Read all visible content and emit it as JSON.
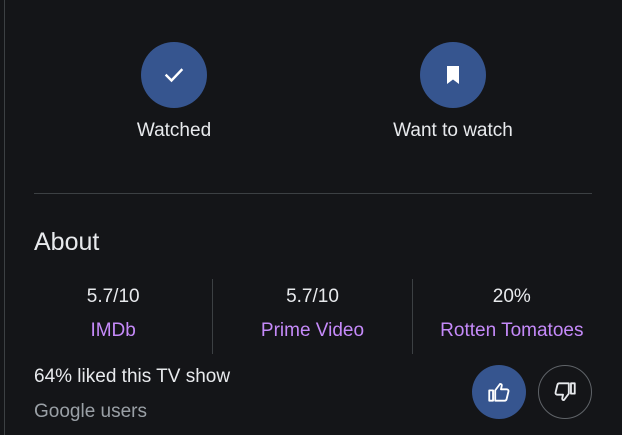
{
  "actions": {
    "watched": {
      "label": "Watched",
      "icon": "check-icon"
    },
    "want_to_watch": {
      "label": "Want to watch",
      "icon": "bookmark-icon"
    }
  },
  "about": {
    "title": "About",
    "ratings": [
      {
        "value": "5.7/10",
        "source": "IMDb"
      },
      {
        "value": "5.7/10",
        "source": "Prime Video"
      },
      {
        "value": "20%",
        "source": "Rotten Tomatoes"
      }
    ]
  },
  "audience": {
    "liked_text": "64% liked this TV show",
    "source_text": "Google users",
    "thumbs_up_icon": "thumbs-up-icon",
    "thumbs_down_icon": "thumbs-down-icon"
  },
  "colors": {
    "background": "#141518",
    "accent_button": "#36558f",
    "link": "#c58af9",
    "divider": "#3c4043",
    "muted_text": "#9aa0a6"
  }
}
